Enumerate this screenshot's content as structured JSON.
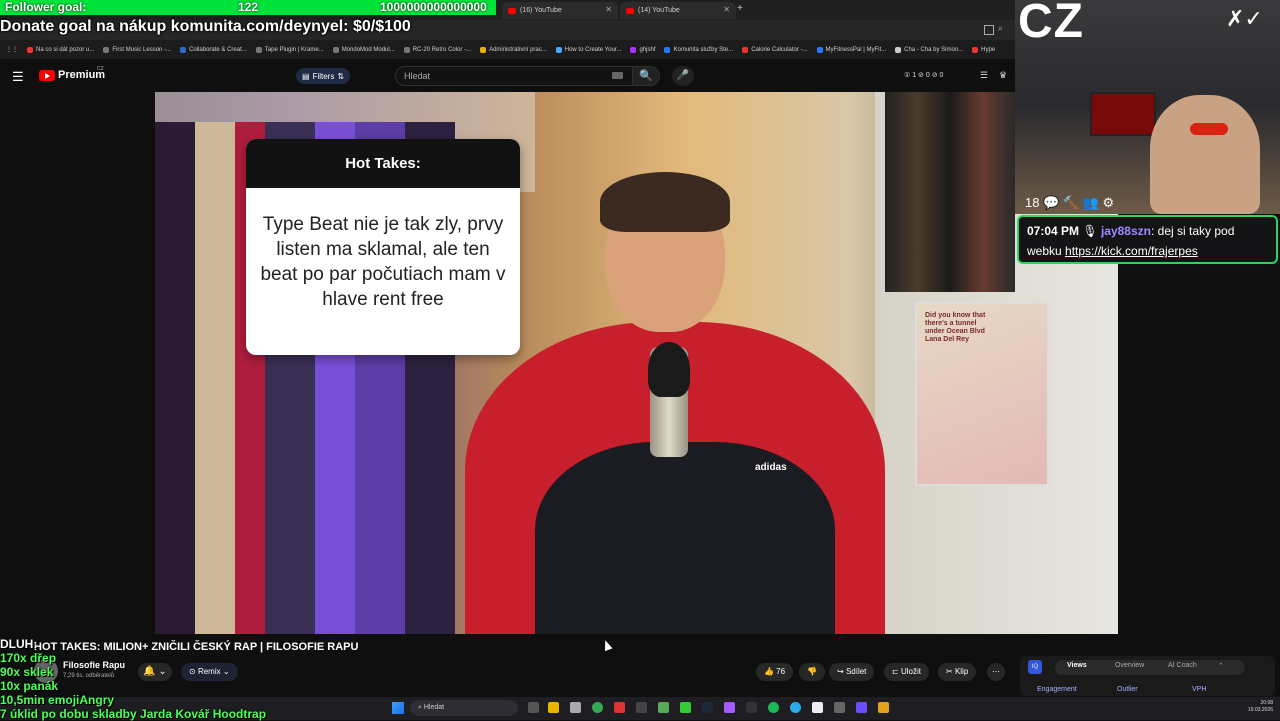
{
  "stream_overlay": {
    "follower_goal_label": "Follower goal:",
    "follower_goal_current": "122",
    "follower_goal_target": "1000000000000000",
    "follower_goal_progress": 0.0,
    "donate_text": "Donate goal na nákup komunita.com/deynyel: $0/$100",
    "cz_logo": "CZ",
    "signature": "✗✓",
    "badges": "18 💬 🔨 👥 ⚙",
    "stats_dluh": "DLUH:",
    "stats_lines": [
      "170x dřep",
      "90x sklek",
      "10x panák",
      "10,5min emojiAngry",
      "7 úklid po dobu skladby Jarda Kovář Hoodtrap"
    ]
  },
  "chat": {
    "time": "07:04 PM",
    "user": "jay88szn",
    "message": ": dej si taky pod webku",
    "link": "https://kick.com/frajerpes"
  },
  "browser": {
    "tabs": [
      "(16) YouTube",
      "(14) YouTube"
    ],
    "new_tab": "+",
    "bookmarks": [
      "Na co si dát pozor u...",
      "First Music Lesson -...",
      "Collaborate & Creat...",
      "Tape Plugin | Krame...",
      "MondoMod Modul...",
      "RC-20 Retro Color -...",
      "Administrativní prac...",
      "How to Create Your...",
      "ghjshf",
      "Komunita služby Ste...",
      "Calorie Calculator -...",
      "MyFitnessPal | MyFit...",
      "Cha - Cha by Simon...",
      "Hype"
    ]
  },
  "youtube": {
    "menu_icon": "☰",
    "logo_text": "Premium",
    "logo_country": "CZ",
    "filters_label": "Filters",
    "search_placeholder": "Hledat",
    "search_icon": "🔍",
    "mic_icon": "🎤",
    "header_stats": "① 1 ⊘ 0 ⊘ 0",
    "video_title": "HOT TAKES: MILION+ ZNIČILI ČESKÝ RAP | FILOSOFIE RAPU",
    "channel_name": "Filosofie Rapu",
    "channel_subs": "7,29 tis. odběratelů",
    "bell": "🔔 ⌄",
    "remix_label": "Remix",
    "like_count": "76",
    "like_label": "👍 76",
    "dislike_label": "👎",
    "share_label": "Sdílet",
    "save_label": "Uložit",
    "clip_label": "Klip",
    "more_label": "⋯"
  },
  "video_card": {
    "header": "Hot Takes:",
    "body": "Type Beat nie je tak zly, prvy listen ma sklamal, ale ten beat po par počutiach mam v hlave rent free"
  },
  "video_scene": {
    "poster_text": "Did you know that there's a tunnel under Ocean Blvd Lana Del Rey",
    "hoodie_logo": "adidas"
  },
  "analytics_panel": {
    "logo": "IQ",
    "tabs": [
      "Views",
      "Overview",
      "AI Coach"
    ],
    "columns": [
      "Engagement",
      "Outlier",
      "VPH"
    ]
  },
  "taskbar": {
    "search_label": "Hledat",
    "time": "20:08",
    "date": "19.03.2026"
  },
  "colors": {
    "goal_green": "#00e33a",
    "stats_green": "#4dff58",
    "chat_border": "#2bd45d",
    "yt_red": "#ff0000"
  }
}
